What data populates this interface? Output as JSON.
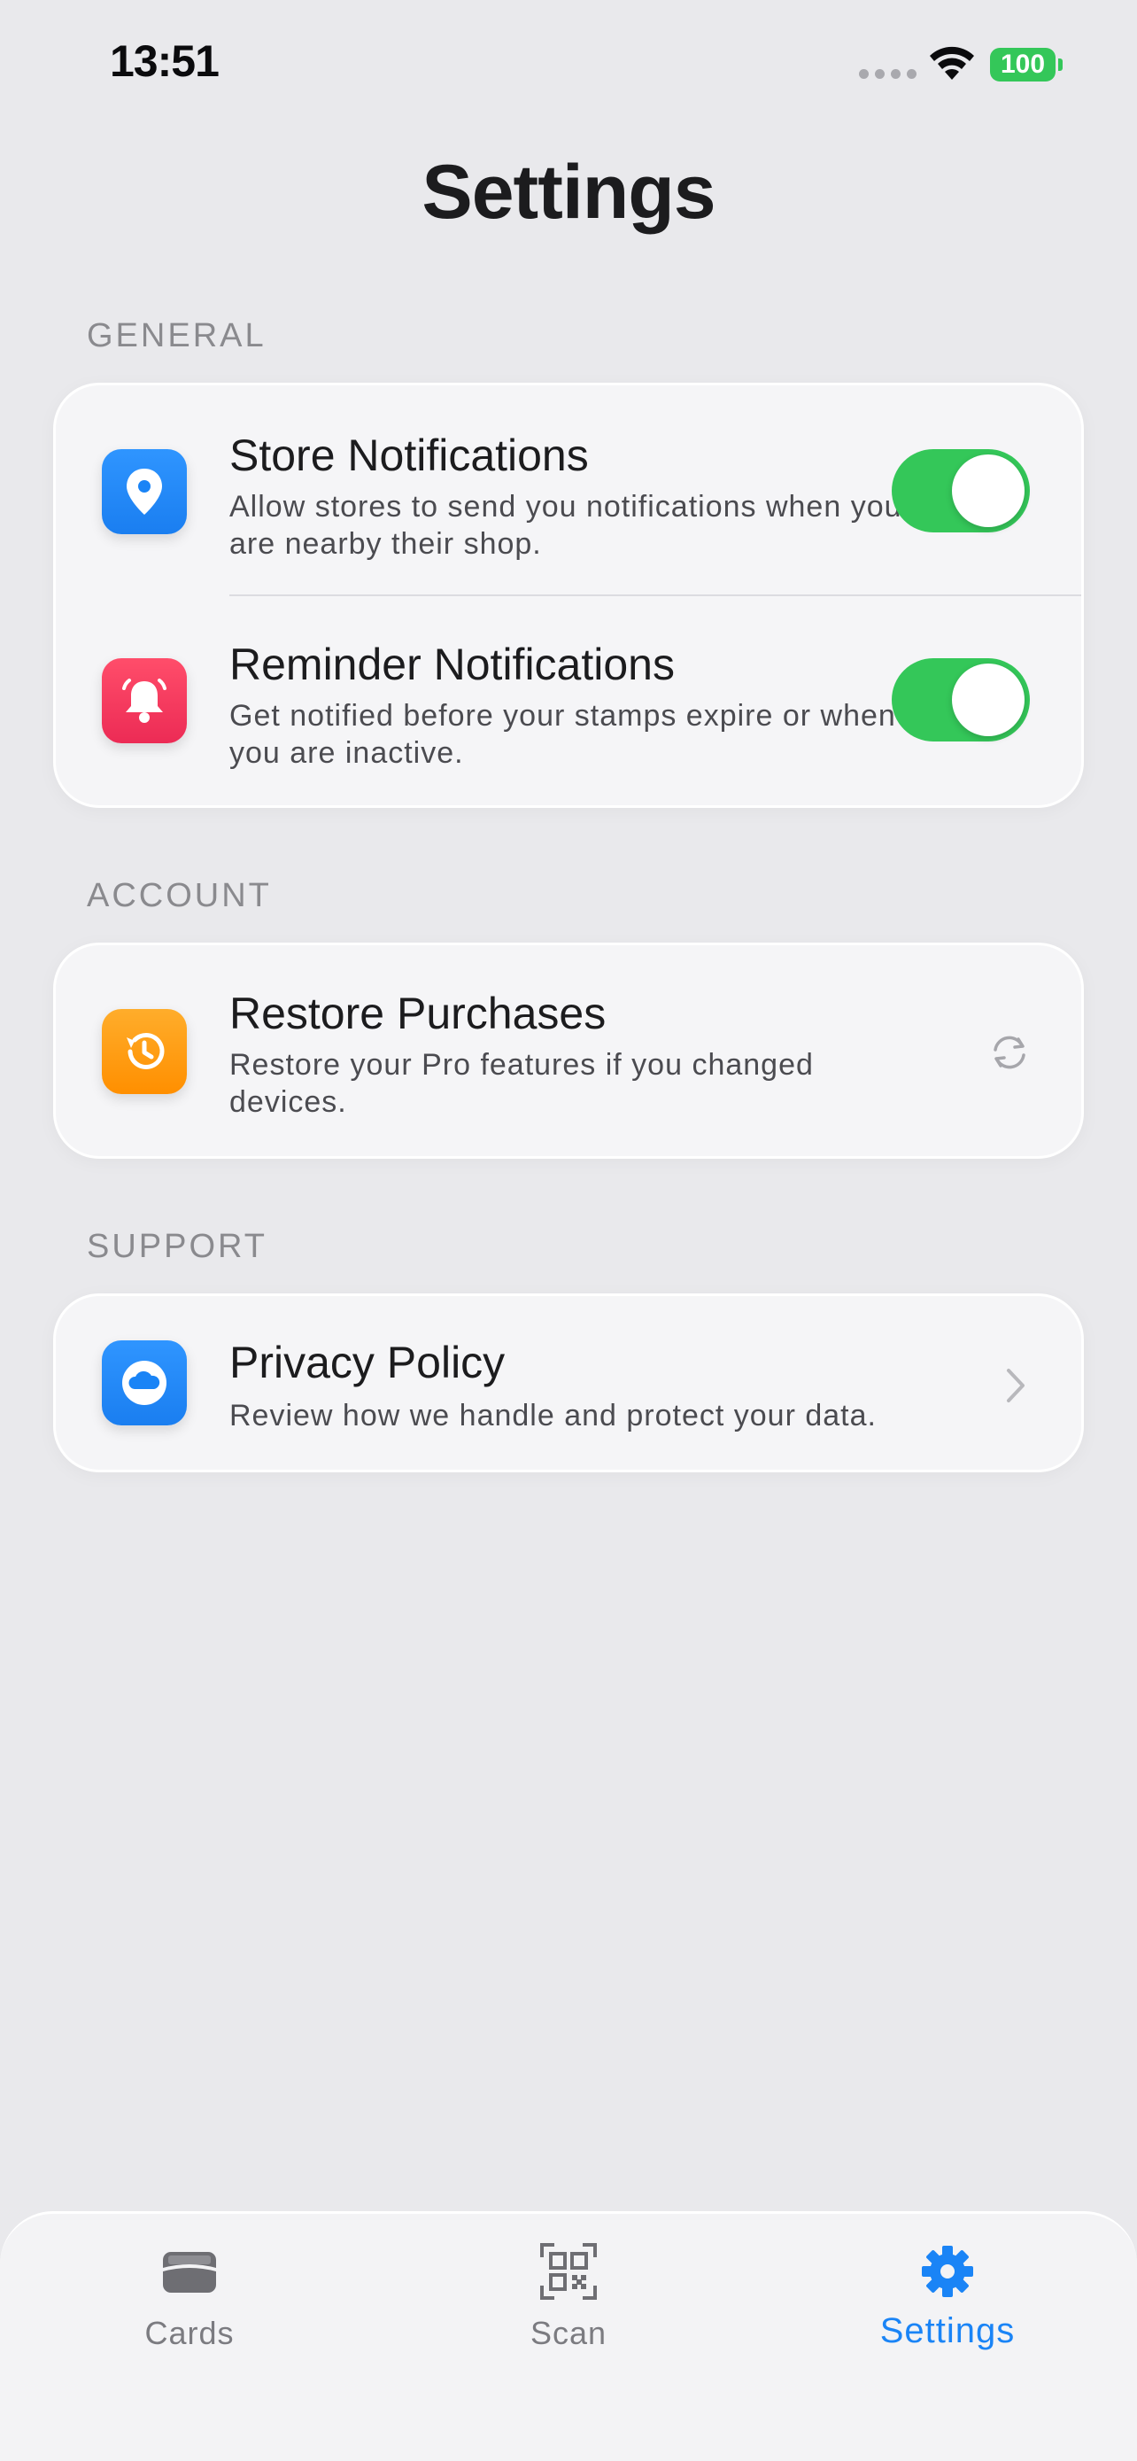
{
  "status_bar": {
    "time": "13:51",
    "battery": "100"
  },
  "title": "Settings",
  "sections": [
    {
      "header": "GENERAL",
      "items": [
        {
          "title": "Store Notifications",
          "subtitle": "Allow stores to send you notifications when you are nearby their shop.",
          "icon": "location-pin-icon",
          "icon_color": "#1a84f6",
          "toggle_on": true
        },
        {
          "title": "Reminder Notifications",
          "subtitle": "Get notified before your stamps expire or when you are inactive.",
          "icon": "bell-icon",
          "icon_color": "#f2385b",
          "toggle_on": true
        }
      ]
    },
    {
      "header": "ACCOUNT",
      "items": [
        {
          "title": "Restore Purchases",
          "subtitle": "Restore your Pro features if you changed devices.",
          "icon": "history-icon",
          "icon_color": "#ff9a0c",
          "trailing": "refresh-icon"
        }
      ]
    },
    {
      "header": "SUPPORT",
      "items": [
        {
          "title": "Privacy Policy",
          "subtitle": "Review how we handle and protect your data.",
          "icon": "cloud-icon",
          "icon_color": "#1a84f6",
          "trailing": "chevron-right-icon"
        }
      ]
    }
  ],
  "tab_bar": {
    "tabs": [
      {
        "label": "Cards",
        "icon": "wallet-card-icon",
        "active": false
      },
      {
        "label": "Scan",
        "icon": "qr-scan-icon",
        "active": false
      },
      {
        "label": "Settings",
        "icon": "gear-icon",
        "active": true
      }
    ]
  },
  "colors": {
    "accent": "#1a84f6",
    "toggle_on": "#34c759",
    "background": "#e9e9ec"
  }
}
